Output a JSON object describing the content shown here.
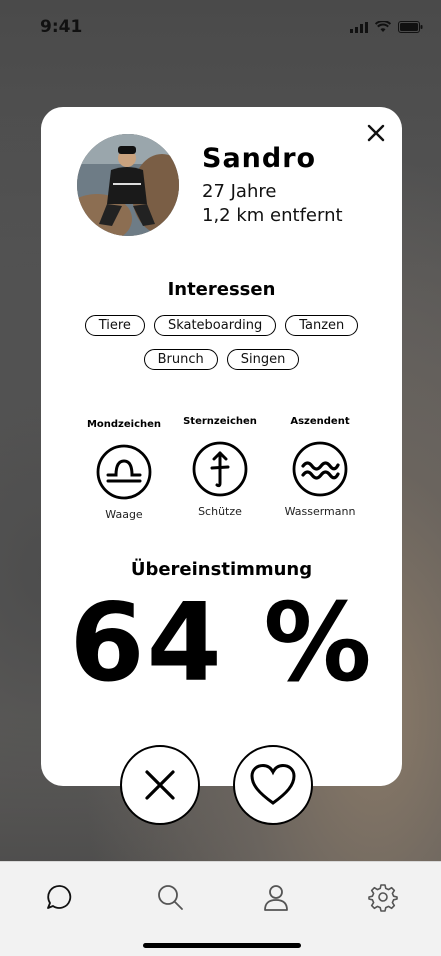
{
  "status_bar": {
    "time": "9:41"
  },
  "profile": {
    "name": "Sandro",
    "age": "27 Jahre",
    "distance": "1,2 km entfernt"
  },
  "interests": {
    "title": "Interessen",
    "row1": [
      "Tiere",
      "Skateboarding",
      "Tanzen"
    ],
    "row2": [
      "Brunch",
      "Singen"
    ]
  },
  "signs": {
    "moon": {
      "title": "Mondzeichen",
      "value": "Waage",
      "icon": "libra-icon"
    },
    "sun": {
      "title": "Sternzeichen",
      "value": "Schütze",
      "icon": "sagittarius-icon"
    },
    "ascendant": {
      "title": "Aszendent",
      "value": "Wassermann",
      "icon": "aquarius-icon"
    }
  },
  "match": {
    "title": "Übereinstimmung",
    "value": "64 %"
  },
  "actions": {
    "dislike_icon": "x-icon",
    "like_icon": "heart-icon"
  },
  "tabbar": {
    "items": [
      "chat-icon",
      "search-icon",
      "profile-icon",
      "settings-icon"
    ]
  },
  "colors": {
    "card": "#ffffff",
    "ink": "#000000",
    "tabbar": "#f2f2f2"
  }
}
